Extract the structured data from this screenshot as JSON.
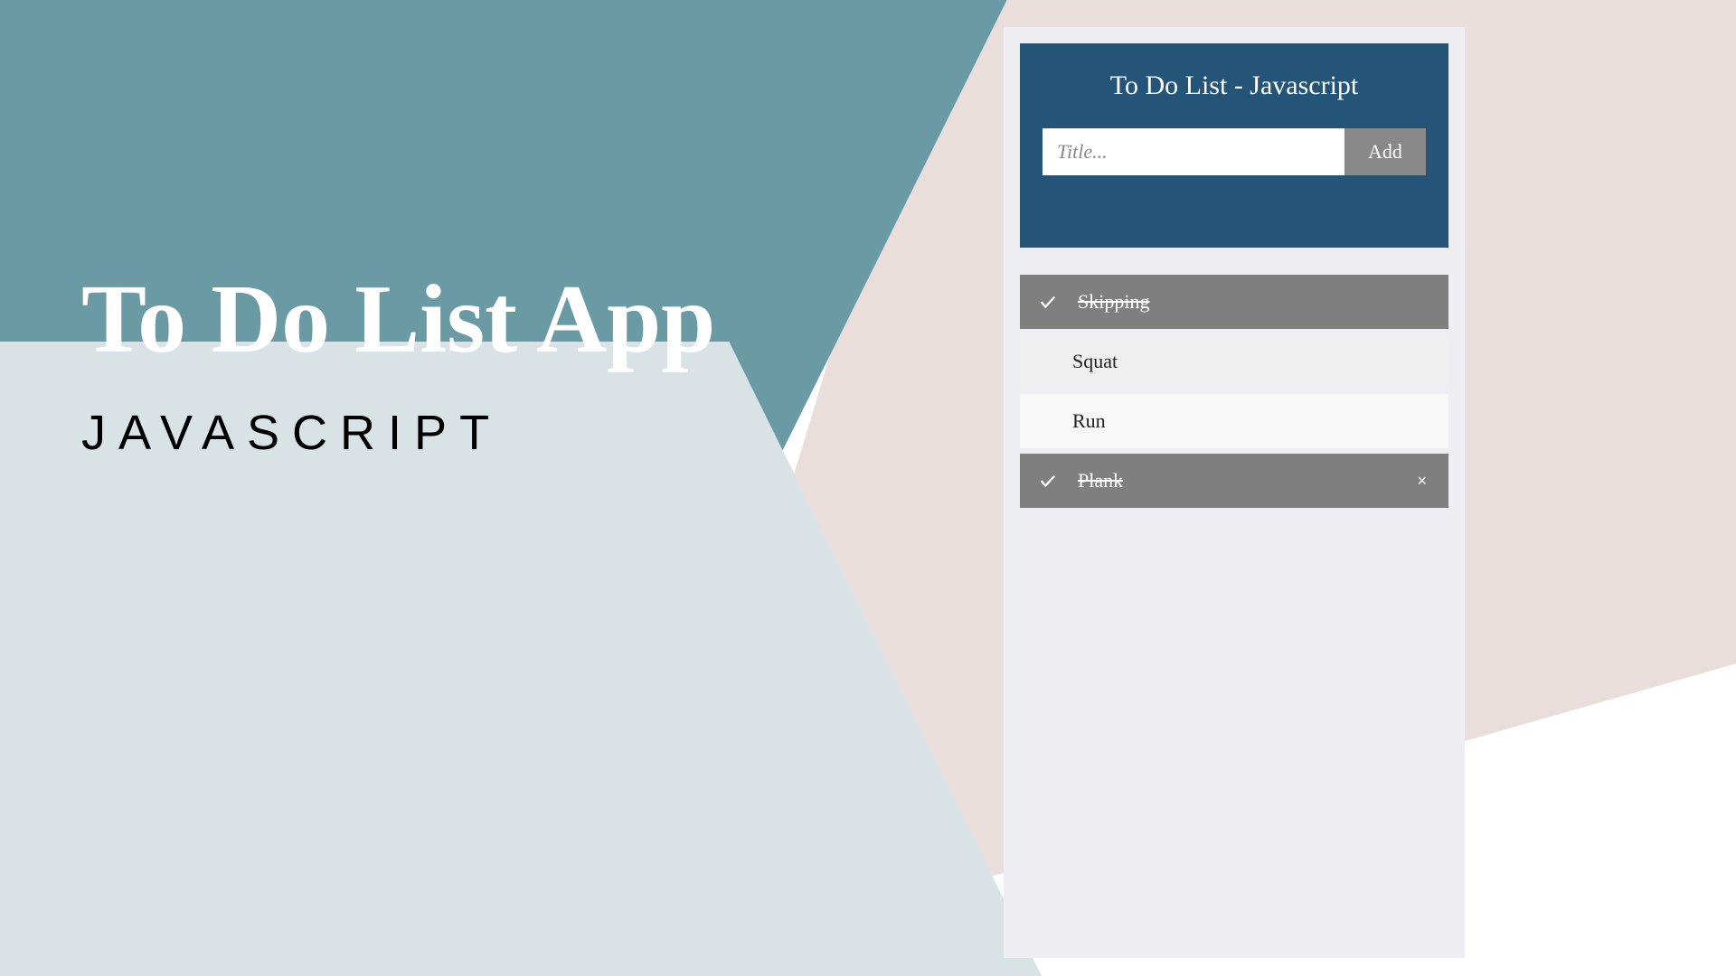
{
  "hero": {
    "title": "To Do List App",
    "subtitle": "JAVASCRIPT"
  },
  "app": {
    "header_title": "To Do List - Javascript",
    "input_placeholder": "Title...",
    "add_label": "Add",
    "items": [
      {
        "text": "Skipping",
        "done": true,
        "show_delete": false
      },
      {
        "text": "Squat",
        "done": false,
        "show_delete": false
      },
      {
        "text": "Run",
        "done": false,
        "show_delete": false
      },
      {
        "text": "Plank",
        "done": true,
        "show_delete": true
      }
    ],
    "delete_symbol": "×"
  },
  "colors": {
    "teal": "#6a9ba4",
    "lightblue": "#d9e2e5",
    "pink": "#eadedc",
    "navy": "#245579",
    "gray": "#7f7f7f"
  }
}
